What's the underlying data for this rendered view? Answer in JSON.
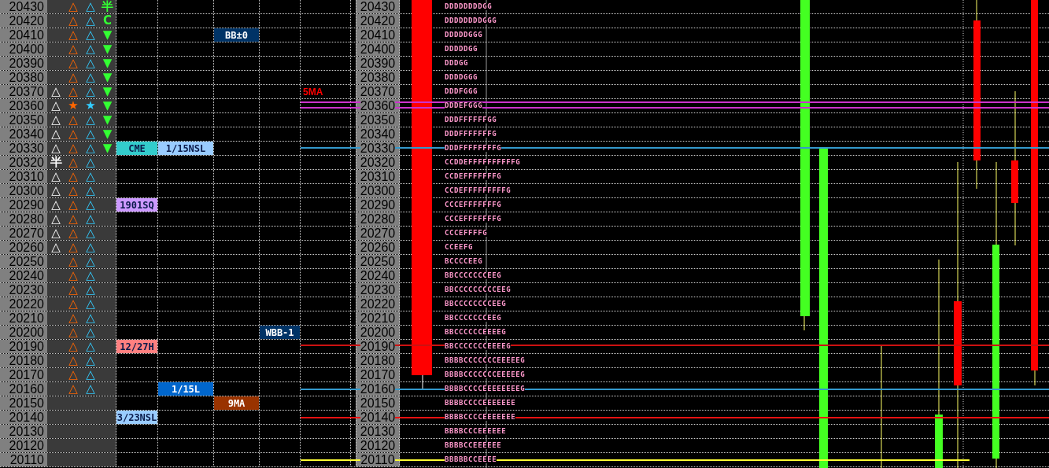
{
  "rows": [
    {
      "price": "20430",
      "marks": {
        "col2": "△",
        "col3": "△",
        "col4": "半"
      },
      "axis_price": "20430",
      "tpo": "DDDDDDDDGG"
    },
    {
      "price": "20420",
      "marks": {
        "col2": "△",
        "col3": "△",
        "col4": "C"
      },
      "axis_price": "20420",
      "tpo": "DDDDDDDDGGG"
    },
    {
      "price": "20410",
      "marks": {
        "col2": "△",
        "col3": "△",
        "col4": "▼"
      },
      "labels": {
        "column_3": {
          "kind": "box",
          "text": "BB±0",
          "color": "#003366"
        }
      },
      "axis_price": "20410",
      "tpo": "DDDDDGGG"
    },
    {
      "price": "20400",
      "marks": {
        "col2": "△",
        "col3": "△",
        "col4": "▼"
      },
      "axis_price": "20400",
      "tpo": "DDDDDGG"
    },
    {
      "price": "20390",
      "marks": {
        "col2": "△",
        "col3": "△",
        "col4": "▼"
      },
      "axis_price": "20390",
      "tpo": "DDDGG"
    },
    {
      "price": "20380",
      "marks": {
        "col2": "△",
        "col3": "△",
        "col4": "▼"
      },
      "axis_price": "20380",
      "tpo": "DDDDGGG"
    },
    {
      "price": "20370",
      "marks": {
        "col1": "△",
        "col2": "△",
        "col3": "△",
        "col4": "▼"
      },
      "labels": {
        "column_5": {
          "kind": "text",
          "text": "5MA",
          "color": "#ff0000"
        }
      },
      "axis_price": "20370",
      "tpo": "DDDFGGG"
    },
    {
      "price": "20360",
      "marks": {
        "col1": "△",
        "col2": "★",
        "col3": "★",
        "col4": "▼"
      },
      "axis_price": "20360",
      "tpo": "DDDEFGGG"
    },
    {
      "price": "20350",
      "marks": {
        "col1": "△",
        "col2": "△",
        "col3": "△",
        "col4": "▼"
      },
      "axis_price": "20350",
      "tpo": "DDDFFFFFFGG"
    },
    {
      "price": "20340",
      "marks": {
        "col1": "△",
        "col2": "△",
        "col3": "△",
        "col4": "▼"
      },
      "axis_price": "20340",
      "tpo": "DDDFFFFFFFG"
    },
    {
      "price": "20330",
      "marks": {
        "col1": "△",
        "col2": "△",
        "col3": "△",
        "col4": "▼"
      },
      "labels": {
        "column_1": {
          "kind": "box",
          "text": "CME",
          "color": "#33cccc"
        },
        "column_2": {
          "kind": "box",
          "text": "1/15NSL",
          "color": "#99ccff"
        }
      },
      "axis_price": "20330",
      "tpo": "DDDFFFFFFFFG"
    },
    {
      "price": "20320",
      "marks": {
        "col1": "半",
        "col2": "△",
        "col3": "△"
      },
      "axis_price": "20320",
      "tpo": "CCDDEFFFFFFFFFFG"
    },
    {
      "price": "20310",
      "marks": {
        "col1": "△",
        "col2": "△",
        "col3": "△"
      },
      "axis_price": "20310",
      "tpo": "CCDEFFFFFFFG"
    },
    {
      "price": "20300",
      "marks": {
        "col1": "△",
        "col2": "△",
        "col3": "△"
      },
      "axis_price": "20300",
      "tpo": "CCDEFFFFFFFFFG"
    },
    {
      "price": "20290",
      "marks": {
        "col1": "△",
        "col2": "△",
        "col3": "△"
      },
      "labels": {
        "column_1": {
          "kind": "box",
          "text": "1901SQ",
          "color": "#cc99ff"
        }
      },
      "axis_price": "20290",
      "tpo": "CCCEFFFFFFFG"
    },
    {
      "price": "20280",
      "marks": {
        "col1": "△",
        "col2": "△",
        "col3": "△"
      },
      "axis_price": "20280",
      "tpo": "CCCEFFFFFFFG"
    },
    {
      "price": "20270",
      "marks": {
        "col1": "△",
        "col2": "△",
        "col3": "△"
      },
      "axis_price": "20270",
      "tpo": "CCCEFFFFG"
    },
    {
      "price": "20260",
      "marks": {
        "col1": "△",
        "col2": "△",
        "col3": "△"
      },
      "axis_price": "20260",
      "tpo": "CCEEFG"
    },
    {
      "price": "20250",
      "marks": {
        "col2": "△",
        "col3": "△"
      },
      "axis_price": "20250",
      "tpo": "BCCCCEEG"
    },
    {
      "price": "20240",
      "marks": {
        "col2": "△",
        "col3": "△"
      },
      "axis_price": "20240",
      "tpo": "BBCCCCCCCEEG"
    },
    {
      "price": "20230",
      "marks": {
        "col2": "△",
        "col3": "△"
      },
      "axis_price": "20230",
      "tpo": "BBCCCCCCCCCEEG"
    },
    {
      "price": "20220",
      "marks": {
        "col2": "△",
        "col3": "△"
      },
      "axis_price": "20220",
      "tpo": "BBCCCCCCCCEEG"
    },
    {
      "price": "20210",
      "marks": {
        "col2": "△",
        "col3": "△"
      },
      "axis_price": "20210",
      "tpo": "BBCCCCCCCEEG"
    },
    {
      "price": "20200",
      "marks": {
        "col2": "△",
        "col3": "△"
      },
      "labels": {
        "column_4": {
          "kind": "box",
          "text": "WBB-1",
          "color": "#003366"
        }
      },
      "axis_price": "20200",
      "tpo": "BBCCCCCCEEEEG"
    },
    {
      "price": "20190",
      "marks": {
        "col2": "△",
        "col3": "△"
      },
      "labels": {
        "column_1": {
          "kind": "box",
          "text": "12/27H",
          "color": "#ff8080"
        }
      },
      "axis_price": "20190",
      "tpo": "BBCCCCCCCEEEEG"
    },
    {
      "price": "20180",
      "marks": {
        "col2": "△",
        "col3": "△"
      },
      "axis_price": "20180",
      "tpo": "BBBBCCCCCCCEEEEEG"
    },
    {
      "price": "20170",
      "marks": {
        "col2": "△",
        "col3": "△"
      },
      "axis_price": "20170",
      "tpo": "BBBBCCCCCCCEEEEEG"
    },
    {
      "price": "20160",
      "marks": {
        "col2": "△",
        "col3": "△"
      },
      "labels": {
        "column_2": {
          "kind": "box",
          "text": "1/15L",
          "color": "#0066cc"
        }
      },
      "axis_price": "20160",
      "tpo": "BBBBCCCCEEEEEEEEG"
    },
    {
      "price": "20150",
      "labels": {
        "column_3": {
          "kind": "box",
          "text": "9MA",
          "color": "#993300"
        }
      },
      "axis_price": "20150",
      "tpo": "BBBBCCCCEEEEEEE"
    },
    {
      "price": "20140",
      "labels": {
        "column_1": {
          "kind": "box",
          "text": "3/23NSL",
          "color": "#99ccff"
        }
      },
      "axis_price": "20140",
      "tpo": "BBBBCCCCEEEEEEE"
    },
    {
      "price": "20130",
      "axis_price": "20130",
      "tpo": "BBBBCCCEEEEEE"
    },
    {
      "price": "20120",
      "axis_price": "20120",
      "tpo": "BBBBCCEEEEEE"
    },
    {
      "price": "20110",
      "axis_price": "20110",
      "tpo": "BBBBBCCEEEE"
    }
  ]
}
